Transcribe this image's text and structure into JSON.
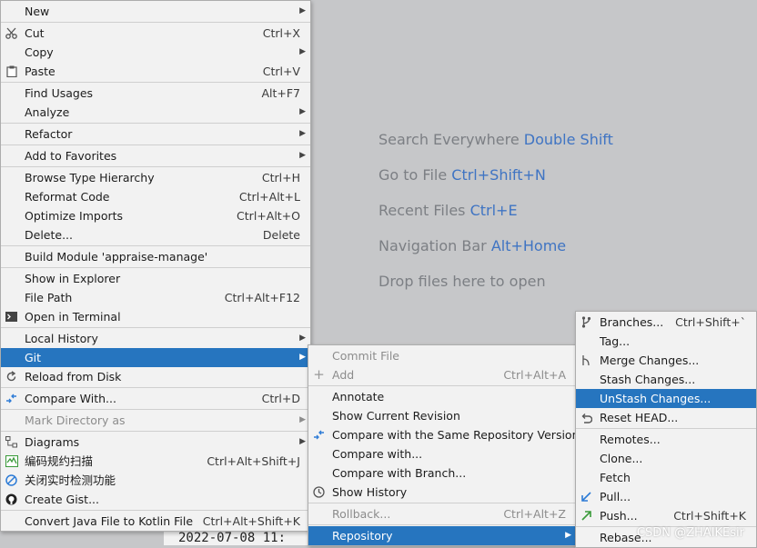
{
  "hints": [
    {
      "text": "Search Everywhere ",
      "key": "Double Shift"
    },
    {
      "text": "Go to File ",
      "key": "Ctrl+Shift+N"
    },
    {
      "text": "Recent Files ",
      "key": "Ctrl+E"
    },
    {
      "text": "Navigation Bar ",
      "key": "Alt+Home"
    },
    {
      "text": "Drop files here to open",
      "key": ""
    }
  ],
  "editor": {
    "code_line": "2022-07-08 11:"
  },
  "main_menu": {
    "new": "New",
    "cut": "Cut",
    "cut_sc": "Ctrl+X",
    "copy": "Copy",
    "paste": "Paste",
    "paste_sc": "Ctrl+V",
    "find_usages": "Find Usages",
    "find_usages_sc": "Alt+F7",
    "analyze": "Analyze",
    "refactor": "Refactor",
    "add_favorites": "Add to Favorites",
    "browse_type": "Browse Type Hierarchy",
    "browse_type_sc": "Ctrl+H",
    "reformat": "Reformat Code",
    "reformat_sc": "Ctrl+Alt+L",
    "optimize": "Optimize Imports",
    "optimize_sc": "Ctrl+Alt+O",
    "delete": "Delete...",
    "delete_sc": "Delete",
    "build_module": "Build Module 'appraise-manage'",
    "show_explorer": "Show in Explorer",
    "file_path": "File Path",
    "file_path_sc": "Ctrl+Alt+F12",
    "open_terminal": "Open in Terminal",
    "local_history": "Local History",
    "git": "Git",
    "reload": "Reload from Disk",
    "compare_with": "Compare With...",
    "compare_with_sc": "Ctrl+D",
    "mark_dir": "Mark Directory as",
    "diagrams": "Diagrams",
    "code_scan": "编码规约扫描",
    "code_scan_sc": "Ctrl+Alt+Shift+J",
    "realtime_off": "关闭实时检测功能",
    "create_gist": "Create Gist...",
    "convert_kotlin": "Convert Java File to Kotlin File",
    "convert_kotlin_sc": "Ctrl+Alt+Shift+K"
  },
  "git_menu": {
    "commit_file": "Commit File",
    "add": "Add",
    "add_sc": "Ctrl+Alt+A",
    "annotate": "Annotate",
    "show_current_rev": "Show Current Revision",
    "compare_same_rev": "Compare with the Same Repository Version",
    "compare_with": "Compare with...",
    "compare_branch": "Compare with Branch...",
    "show_history": "Show History",
    "rollback": "Rollback...",
    "rollback_sc": "Ctrl+Alt+Z",
    "repository": "Repository"
  },
  "repo_menu": {
    "branches": "Branches...",
    "branches_sc": "Ctrl+Shift+`",
    "tag": "Tag...",
    "merge_changes": "Merge Changes...",
    "stash_changes": "Stash Changes...",
    "unstash_changes": "UnStash Changes...",
    "reset_head": "Reset HEAD...",
    "remotes": "Remotes...",
    "clone": "Clone...",
    "fetch": "Fetch",
    "pull": "Pull...",
    "push": "Push...",
    "push_sc": "Ctrl+Shift+K",
    "rebase": "Rebase..."
  },
  "watermark": "CSDN @ZHAIKEsir",
  "icons": {
    "cut": "scissors-icon",
    "paste": "clipboard-icon",
    "terminal": "terminal-icon",
    "reload": "reload-icon",
    "compare": "compare-arrows-icon",
    "diagrams": "diagrams-icon",
    "scan": "scan-icon",
    "disable": "prohibited-icon",
    "github": "github-icon",
    "branch": "branch-icon",
    "reset": "undo-icon",
    "pull": "pull-arrow-icon",
    "push": "push-arrow-icon",
    "history": "clock-icon"
  },
  "colors": {
    "selection": "#2675bf",
    "hint_key": "#3f74c3",
    "background": "#c6c7c9",
    "menu": "#f2f2f2"
  }
}
